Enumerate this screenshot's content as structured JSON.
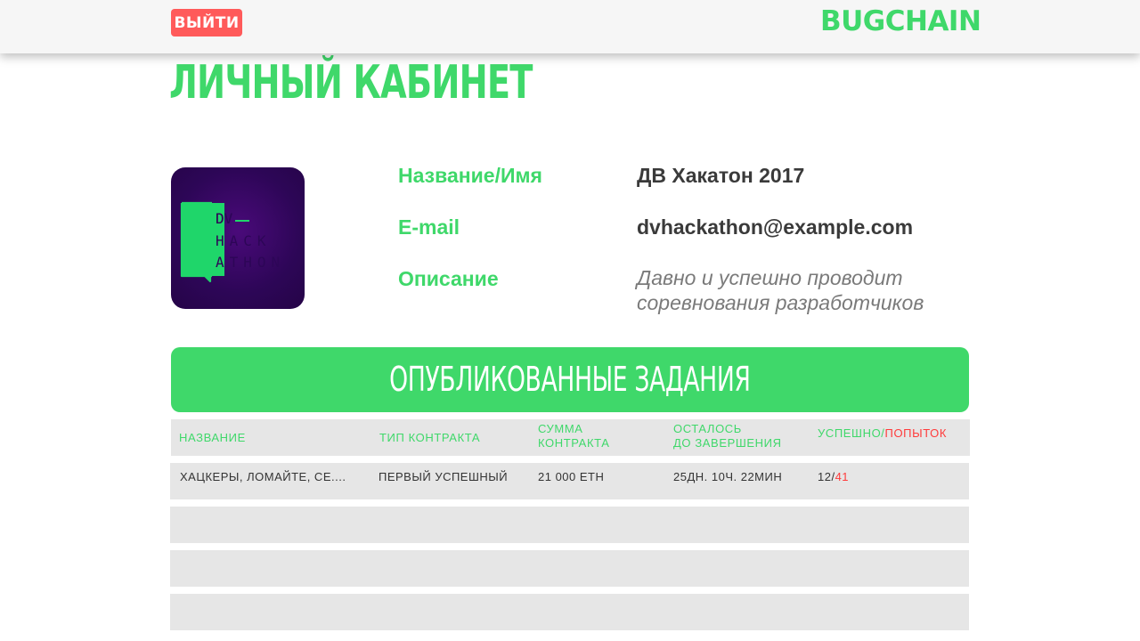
{
  "header": {
    "logout_label": "ВЫЙТИ",
    "logo_text": "BUGCHAIN"
  },
  "page": {
    "title": "ЛИЧНЫЙ КАБИНЕТ"
  },
  "profile": {
    "avatar_lines": [
      "DV",
      "HACK",
      "ATHON"
    ],
    "name_label": "Название/Имя",
    "name_value": "ДВ Хакатон 2017",
    "email_label": "E-mail",
    "email_value": "dvhackathon@example.com",
    "description_label": "Описание",
    "description_value": "Давно и успешно проводит соревнования разработчиков"
  },
  "tasks": {
    "section_title": "ОПУБЛИКОВАННЫЕ ЗАДАНИЯ",
    "columns": {
      "name": "НАЗВАНИЕ",
      "contract_type": "ТИП КОНТРАКТА",
      "contract_sum_line1": "СУММА",
      "contract_sum_line2": "КОНТРАКТА",
      "remaining_line1": "ОСТАЛОСЬ",
      "remaining_line2": "ДО ЗАВЕРШЕНИЯ",
      "success": "УСПЕШНО/",
      "attempts": "ПОПЫТОК"
    },
    "rows": [
      {
        "name": "ХАЦКЕРЫ, ЛОМАЙТЕ, СЕ....",
        "contract_type": "ПЕРВЫЙ УСПЕШНЫЙ",
        "contract_sum": "21 000 ETH",
        "remaining": "25ДН. 10Ч. 22МИН",
        "success": "12/",
        "attempts": "41"
      }
    ]
  },
  "colors": {
    "accent_green": "#3fd86a",
    "logout_red": "#ff5a5a",
    "attempts_red": "#ff3b3b",
    "avatar_purple": "#2d0657",
    "row_gray": "#e6e6e6"
  }
}
